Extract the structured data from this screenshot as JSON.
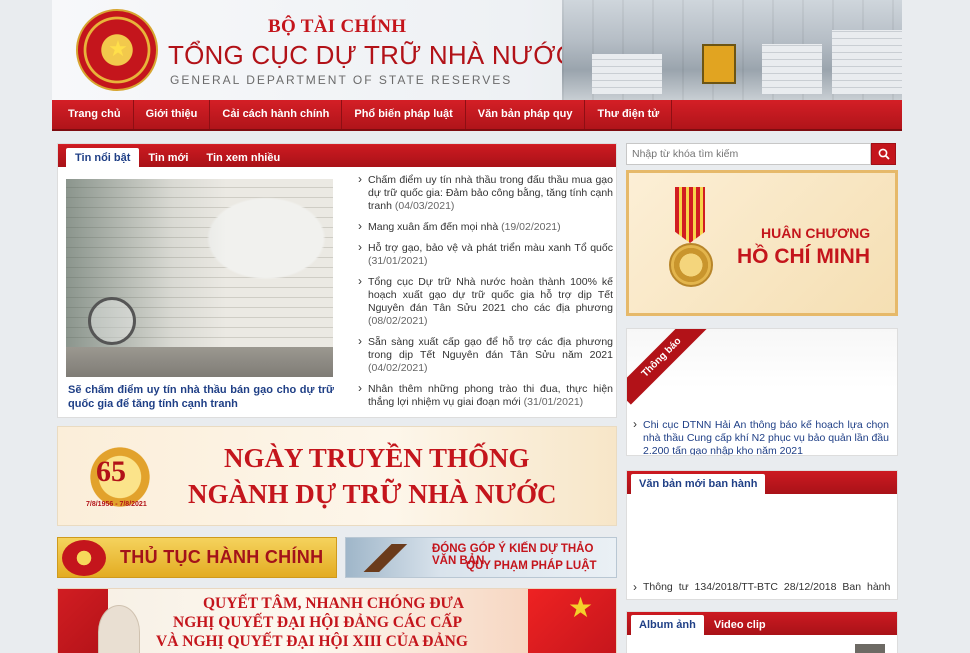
{
  "header": {
    "ministry": "BỘ TÀI CHÍNH",
    "title": "TỔNG CỤC DỰ TRỮ NHÀ NƯỚC",
    "english": "GENERAL DEPARTMENT OF STATE RESERVES"
  },
  "nav": {
    "items": [
      "Trang chủ",
      "Giới thiệu",
      "Cải cách hành chính",
      "Phổ biến pháp luật",
      "Văn bản pháp quy",
      "Thư điện tử"
    ]
  },
  "news": {
    "tabs": [
      "Tin nổi bật",
      "Tin mới",
      "Tin xem nhiều"
    ],
    "active_tab": "Tin nổi bật",
    "featured_caption": "Sẽ chấm điểm uy tín nhà thầu bán gạo cho dự trữ quốc gia để tăng tính cạnh tranh",
    "items": [
      {
        "title": "Chấm điểm uy tín nhà thầu trong đấu thầu mua gạo dự trữ quốc gia: Đảm bảo công bằng, tăng tính cạnh tranh",
        "date": "(04/03/2021)"
      },
      {
        "title": "Mang xuân ấm đến mọi nhà",
        "date": "(19/02/2021)"
      },
      {
        "title": "Hỗ trợ gạo, bảo vệ và phát triển màu xanh Tổ quốc",
        "date": "(31/01/2021)"
      },
      {
        "title": "Tổng cục Dự trữ Nhà nước hoàn thành 100% kế hoạch xuất gạo dự trữ quốc gia hỗ trợ dịp Tết Nguyên đán Tân Sửu 2021 cho các địa phương",
        "date": "(08/02/2021)"
      },
      {
        "title": "Sẵn sàng xuất cấp gạo để hỗ trợ các địa phương trong dịp Tết Nguyên đán Tân Sửu năm 2021",
        "date": "(04/02/2021)"
      },
      {
        "title": "Nhân thêm những phong trào thi đua, thực hiện thắng lợi nhiệm vụ giai đoạn mới",
        "date": "(31/01/2021)"
      }
    ]
  },
  "banners": {
    "anniversary_number": "65",
    "anniversary_years": "7/8/1956 - 7/8/2021",
    "anniversary_line1": "NGÀY TRUYỀN THỐNG",
    "anniversary_line2": "NGÀNH DỰ TRỮ NHÀ NƯỚC",
    "procedures": "THỦ TỤC HÀNH CHÍNH",
    "feedback_line1": "ĐÓNG GÓP Ý KIẾN DỰ THẢO VĂN BẢN",
    "feedback_line2": "QUY PHẠM PHÁP LUẬT",
    "congress_line1": "QUYẾT TÂM, NHANH CHÓNG ĐƯA",
    "congress_line2": "NGHỊ QUYẾT ĐẠI HỘI ĐẢNG CÁC CẤP",
    "congress_line3": "VÀ NGHỊ QUYẾT ĐẠI HỘI XIII CỦA ĐẢNG"
  },
  "search": {
    "placeholder": "Nhập từ khóa tìm kiếm"
  },
  "award": {
    "line1": "HUÂN CHƯƠNG",
    "line2": "HỒ CHÍ MINH"
  },
  "notice": {
    "label": "Thông báo",
    "text": "Chi cục DTNN Hải An thông báo kế hoạch lựa chọn nhà thầu Cung cấp khí N2 phục vụ bảo quản lần đầu 2.200 tấn gạo nhập kho năm 2021"
  },
  "documents": {
    "tab": "Văn bản mới ban hành",
    "item": "Thông tư 134/2018/TT-BTC 28/12/2018 Ban hành"
  },
  "album": {
    "tabs": [
      "Album ảnh",
      "Video clip"
    ]
  },
  "colors": {
    "brand_red": "#c4151c",
    "link_blue": "#1f3f86"
  }
}
